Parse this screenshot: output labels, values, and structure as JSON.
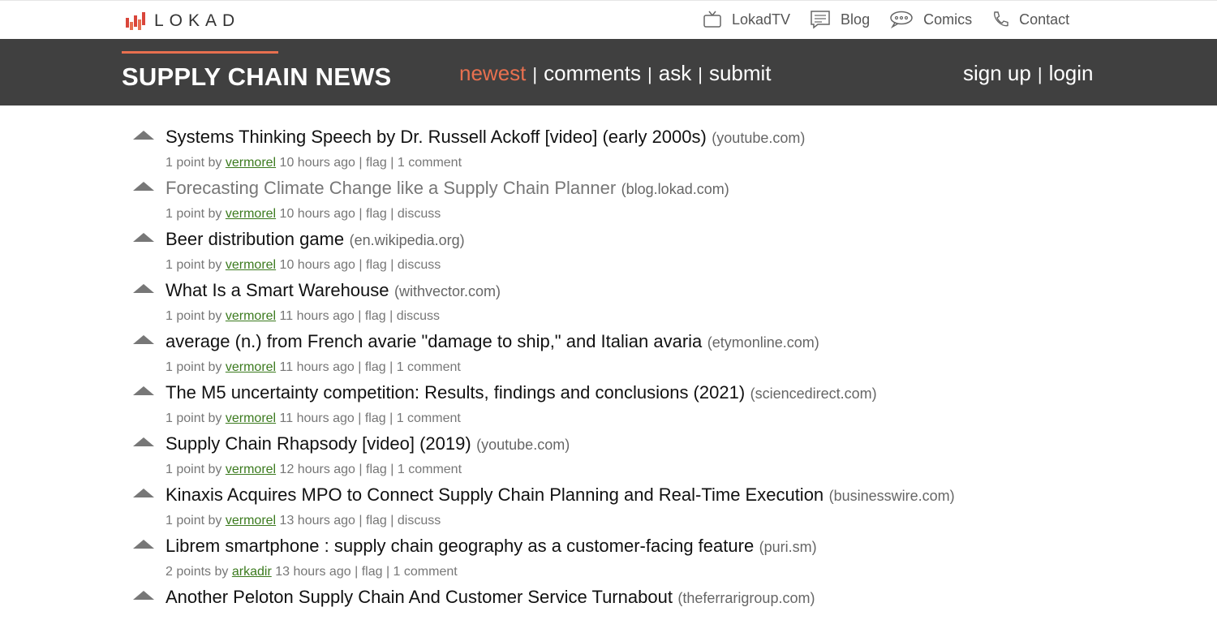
{
  "brand": {
    "logo_text": "LOKAD"
  },
  "topnav": [
    {
      "label": "LokadTV",
      "icon": "tv-icon"
    },
    {
      "label": "Blog",
      "icon": "blog-icon"
    },
    {
      "label": "Comics",
      "icon": "comics-icon"
    },
    {
      "label": "Contact",
      "icon": "phone-icon"
    }
  ],
  "header": {
    "title": "SUPPLY CHAIN NEWS",
    "nav": {
      "newest": "newest",
      "comments": "comments",
      "ask": "ask",
      "submit": "submit",
      "sep": "|"
    },
    "user": {
      "signup": "sign up",
      "login": "login",
      "sep": "|"
    }
  },
  "colors": {
    "accent": "#e8704f",
    "header_bg": "#404040",
    "user_link": "#3b7a1e"
  },
  "stories": [
    {
      "title": "Systems Thinking Speech by Dr. Russell Ackoff [video] (early 2000s)",
      "domain": "(youtube.com)",
      "visited": false,
      "points": "1 point",
      "by": "by",
      "user": "vermorel",
      "age": "10 hours ago",
      "flag": "flag",
      "discussion": "1 comment"
    },
    {
      "title": "Forecasting Climate Change like a Supply Chain Planner",
      "domain": "(blog.lokad.com)",
      "visited": true,
      "points": "1 point",
      "by": "by",
      "user": "vermorel",
      "age": "10 hours ago",
      "flag": "flag",
      "discussion": "discuss"
    },
    {
      "title": "Beer distribution game",
      "domain": "(en.wikipedia.org)",
      "visited": false,
      "points": "1 point",
      "by": "by",
      "user": "vermorel",
      "age": "10 hours ago",
      "flag": "flag",
      "discussion": "discuss"
    },
    {
      "title": "What Is a Smart Warehouse",
      "domain": "(withvector.com)",
      "visited": false,
      "points": "1 point",
      "by": "by",
      "user": "vermorel",
      "age": "11 hours ago",
      "flag": "flag",
      "discussion": "discuss"
    },
    {
      "title": "average (n.) from French avarie \"damage to ship,\" and Italian avaria",
      "domain": "(etymonline.com)",
      "visited": false,
      "points": "1 point",
      "by": "by",
      "user": "vermorel",
      "age": "11 hours ago",
      "flag": "flag",
      "discussion": "1 comment"
    },
    {
      "title": "The M5 uncertainty competition: Results, findings and conclusions (2021)",
      "domain": "(sciencedirect.com)",
      "visited": false,
      "points": "1 point",
      "by": "by",
      "user": "vermorel",
      "age": "11 hours ago",
      "flag": "flag",
      "discussion": "1 comment"
    },
    {
      "title": "Supply Chain Rhapsody [video] (2019)",
      "domain": "(youtube.com)",
      "visited": false,
      "points": "1 point",
      "by": "by",
      "user": "vermorel",
      "age": "12 hours ago",
      "flag": "flag",
      "discussion": "1 comment"
    },
    {
      "title": "Kinaxis Acquires MPO to Connect Supply Chain Planning and Real-Time Execution",
      "domain": "(businesswire.com)",
      "visited": false,
      "points": "1 point",
      "by": "by",
      "user": "vermorel",
      "age": "13 hours ago",
      "flag": "flag",
      "discussion": "discuss"
    },
    {
      "title": "Librem smartphone : supply chain geography as a customer-facing feature",
      "domain": "(puri.sm)",
      "visited": false,
      "points": "2 points",
      "by": "by",
      "user": "arkadir",
      "age": "13 hours ago",
      "flag": "flag",
      "discussion": "1 comment"
    },
    {
      "title": "Another Peloton Supply Chain And Customer Service Turnabout",
      "domain": "(theferrarigroup.com)",
      "visited": false,
      "points": "",
      "by": "",
      "user": "",
      "age": "",
      "flag": "",
      "discussion": ""
    }
  ]
}
